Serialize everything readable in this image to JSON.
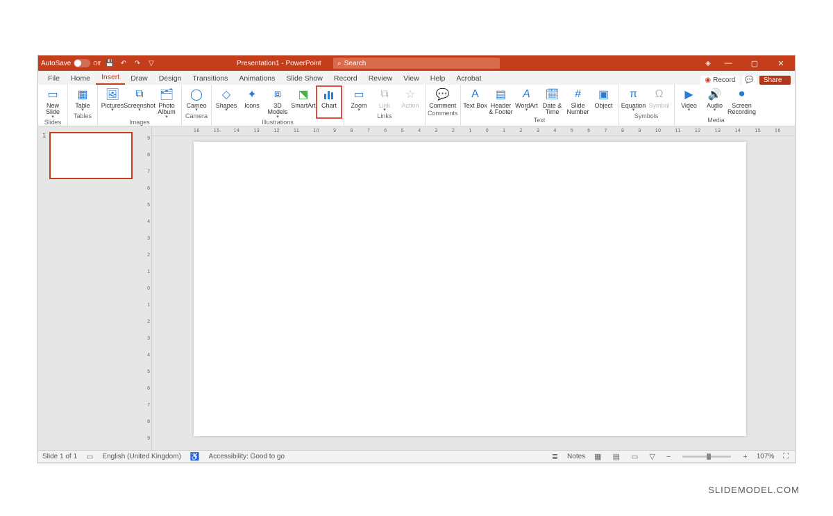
{
  "autosave_label": "AutoSave",
  "autosave_state": "Off",
  "window_title": "Presentation1 - PowerPoint",
  "search_placeholder": "Search",
  "record_label": "Record",
  "share_label": "Share",
  "tabs": [
    "File",
    "Home",
    "Insert",
    "Draw",
    "Design",
    "Transitions",
    "Animations",
    "Slide Show",
    "Record",
    "Review",
    "View",
    "Help",
    "Acrobat"
  ],
  "active_tab": "Insert",
  "ribbon": {
    "slides": {
      "label": "Slides",
      "new_slide": "New Slide"
    },
    "tables": {
      "label": "Tables",
      "table": "Table"
    },
    "images": {
      "label": "Images",
      "pictures": "Pictures",
      "screenshot": "Screenshot",
      "photo_album": "Photo Album"
    },
    "camera": {
      "label": "Camera",
      "cameo": "Cameo"
    },
    "illustrations": {
      "label": "Illustrations",
      "shapes": "Shapes",
      "icons": "Icons",
      "models": "3D Models",
      "smartart": "SmartArt",
      "chart": "Chart"
    },
    "links": {
      "label": "Links",
      "zoom": "Zoom",
      "link": "Link",
      "action": "Action"
    },
    "comments": {
      "label": "Comments",
      "comment": "Comment"
    },
    "text": {
      "label": "Text",
      "textbox": "Text Box",
      "header": "Header & Footer",
      "wordart": "WordArt",
      "date": "Date & Time",
      "slideno": "Slide Number",
      "object": "Object"
    },
    "symbols": {
      "label": "Symbols",
      "equation": "Equation",
      "symbol": "Symbol"
    },
    "media": {
      "label": "Media",
      "video": "Video",
      "audio": "Audio",
      "screen": "Screen Recording"
    }
  },
  "thumb_number": "1",
  "ruler_h": [
    "16",
    "15",
    "14",
    "13",
    "12",
    "11",
    "10",
    "9",
    "8",
    "7",
    "6",
    "5",
    "4",
    "3",
    "2",
    "1",
    "0",
    "1",
    "2",
    "3",
    "4",
    "5",
    "6",
    "7",
    "8",
    "9",
    "10",
    "11",
    "12",
    "13",
    "14",
    "15",
    "16"
  ],
  "ruler_v": [
    "9",
    "8",
    "7",
    "6",
    "5",
    "4",
    "3",
    "2",
    "1",
    "0",
    "1",
    "2",
    "3",
    "4",
    "5",
    "6",
    "7",
    "8",
    "9"
  ],
  "status": {
    "slide": "Slide 1 of 1",
    "lang": "English (United Kingdom)",
    "a11y": "Accessibility: Good to go",
    "notes": "Notes",
    "zoom": "107%"
  },
  "watermark": "SLIDEMODEL.COM"
}
